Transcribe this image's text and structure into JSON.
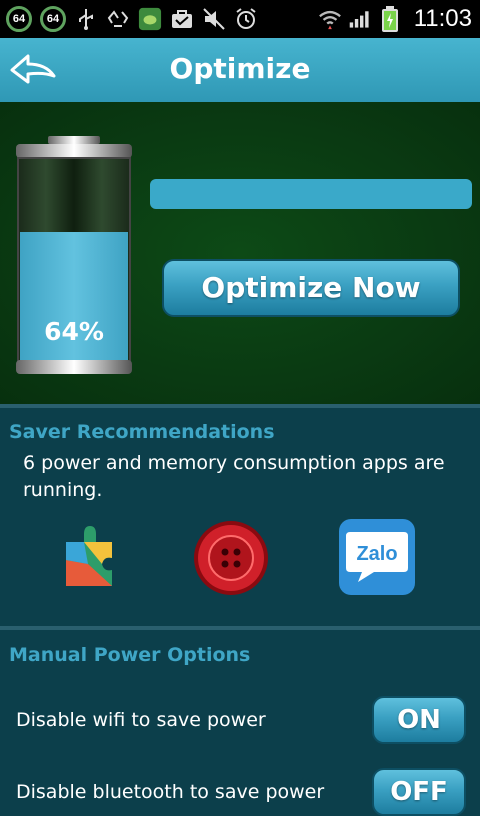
{
  "status_bar": {
    "badge_left": "64",
    "badge_right": "64",
    "time": "11:03",
    "icons": [
      "usb-icon",
      "recycle-icon",
      "app-icon",
      "briefcase-icon",
      "mute-icon",
      "alarm-icon",
      "wifi-icon",
      "signal-icon",
      "battery-charging-icon"
    ]
  },
  "header": {
    "title": "Optimize"
  },
  "battery": {
    "level_percent": 64,
    "label": "64%"
  },
  "actions": {
    "optimize_label": "Optimize Now"
  },
  "saver": {
    "heading": "Saver Recommendations",
    "text": "6 power and memory consumption apps are running.",
    "apps": [
      {
        "name": "google-play-services-icon"
      },
      {
        "name": "red-button-app-icon"
      },
      {
        "name": "zalo-icon",
        "label": "Zalo"
      }
    ]
  },
  "manual": {
    "heading": "Manual Power Options",
    "options": [
      {
        "label": "Disable wifi to save power",
        "state": "ON"
      },
      {
        "label": "Disable bluetooth to save power",
        "state": "OFF"
      }
    ]
  },
  "colors": {
    "accent": "#3fa6c6",
    "background": "#0c3f4b",
    "hero_bg": "#0a3a12",
    "title_bar": "#3aa9c9"
  }
}
